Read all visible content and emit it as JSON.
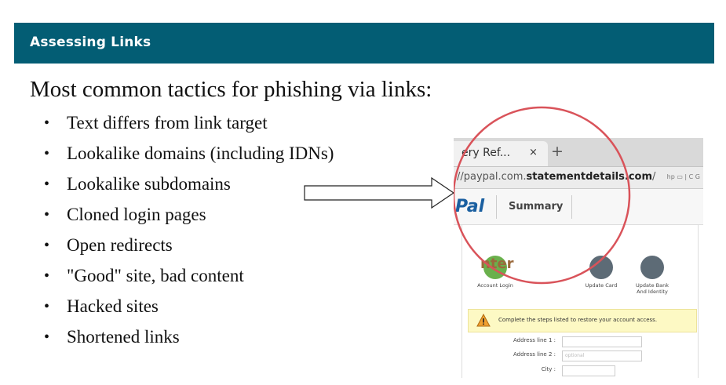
{
  "header": {
    "title": "Assessing Links"
  },
  "heading": "Most common tactics for phishing via links:",
  "bullets": [
    "Text differs from link target",
    "Lookalike domains (including IDNs)",
    "Lookalike subdomains",
    "Cloned login pages",
    "Open redirects",
    "\"Good\" site, bad content",
    "Hacked sites",
    "Shortened links"
  ],
  "bullet_glyph": "•",
  "screenshot": {
    "tab_label": "ery Ref...",
    "tab_close": "×",
    "tab_new": "+",
    "url_prefix": "//paypal.com.",
    "url_bold": "statementdetails.com",
    "url_suffix": "/",
    "url_icons": "hp   ▭ | C  G",
    "logo": "Pal",
    "summary": "Summary",
    "enter_text": "nter",
    "steps": [
      "Account Login",
      "Update Card",
      "Update Bank And Identity"
    ],
    "warning_text": "Complete the steps listed to restore your account access.",
    "fields": [
      {
        "label": "Address line 1 :",
        "placeholder": ""
      },
      {
        "label": "Address line 2 :",
        "placeholder": "optional"
      },
      {
        "label": "City :",
        "placeholder": ""
      }
    ]
  },
  "colors": {
    "header_bg": "#035d74",
    "magnifier": "#d9535a",
    "warning_bg": "#fdf9c4"
  }
}
